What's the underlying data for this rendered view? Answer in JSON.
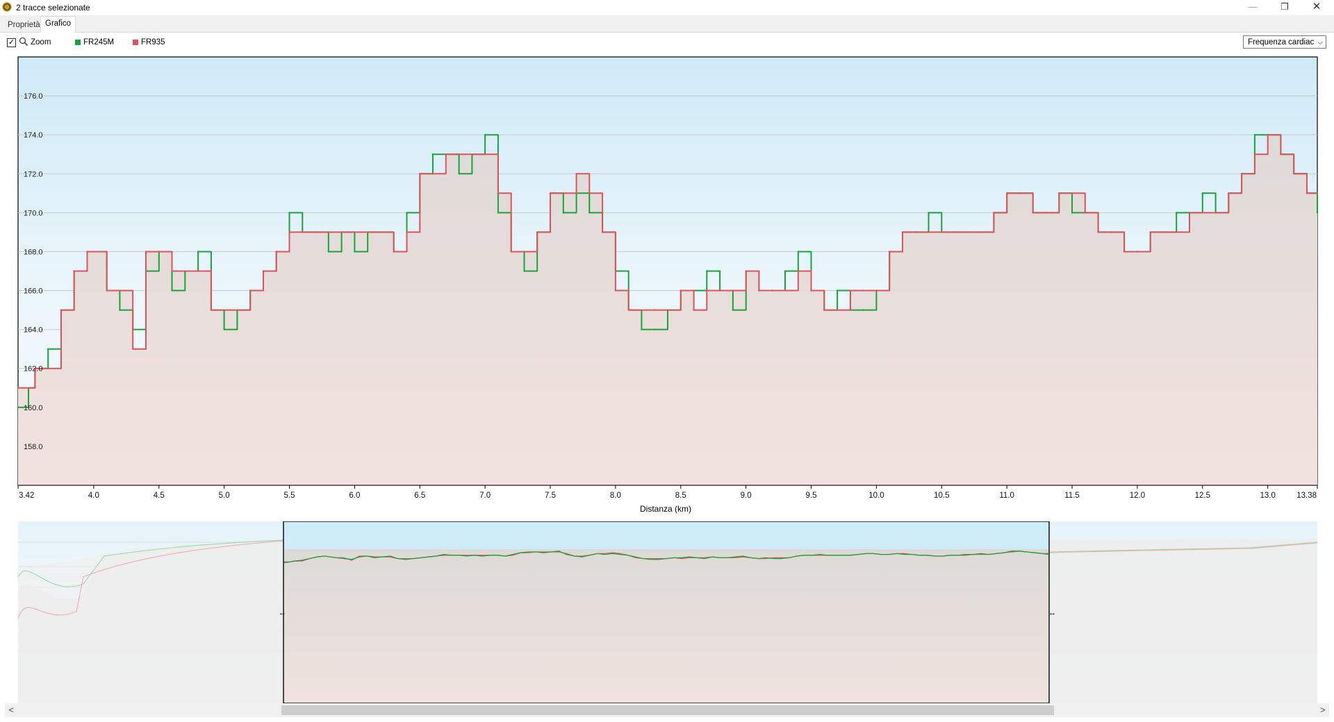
{
  "window": {
    "title": "2 tracce selezionate"
  },
  "window_buttons": {
    "minimize": "—",
    "restore": "❐",
    "close": "✕"
  },
  "tabs": [
    {
      "label": "Proprietà"
    },
    {
      "label": "Grafico"
    }
  ],
  "toolbar": {
    "zoom_checked": true,
    "zoom_label": "Zoom",
    "metric_select": "Frequenza cardiac"
  },
  "colors": {
    "FR245M": "#1aa33a",
    "FR935": "#e0525a"
  },
  "scrollbar": {
    "left_arrow": "<",
    "right_arrow": ">"
  },
  "chart_data": {
    "type": "line",
    "xlabel": "Distanza  (km)",
    "ylabel": "",
    "xlim": [
      3.42,
      13.38
    ],
    "ylim": [
      156.0,
      178.0
    ],
    "x_ticks": [
      "3.42",
      "4.0",
      "4.5",
      "5.0",
      "5.5",
      "6.0",
      "6.5",
      "7.0",
      "7.5",
      "8.0",
      "8.5",
      "9.0",
      "9.5",
      "10.0",
      "10.5",
      "11.0",
      "11.5",
      "12.0",
      "12.5",
      "13.0",
      "13.38"
    ],
    "y_ticks": [
      "158.0",
      "160.0",
      "162.0",
      "164.0",
      "166.0",
      "168.0",
      "170.0",
      "172.0",
      "174.0",
      "176.0"
    ],
    "grid": true,
    "legend": "top-left",
    "series": [
      {
        "name": "FR245M",
        "x": [
          3.42,
          3.5,
          3.55,
          3.65,
          3.75,
          3.85,
          3.95,
          4.1,
          4.2,
          4.3,
          4.4,
          4.5,
          4.6,
          4.7,
          4.8,
          4.9,
          5.0,
          5.1,
          5.2,
          5.3,
          5.4,
          5.5,
          5.6,
          5.7,
          5.8,
          5.9,
          6.0,
          6.1,
          6.2,
          6.3,
          6.4,
          6.5,
          6.6,
          6.7,
          6.8,
          6.9,
          7.0,
          7.1,
          7.2,
          7.3,
          7.4,
          7.5,
          7.6,
          7.7,
          7.8,
          7.9,
          8.0,
          8.1,
          8.2,
          8.3,
          8.4,
          8.5,
          8.6,
          8.7,
          8.8,
          8.9,
          9.0,
          9.1,
          9.2,
          9.3,
          9.4,
          9.5,
          9.6,
          9.7,
          9.8,
          9.9,
          10.0,
          10.1,
          10.2,
          10.3,
          10.4,
          10.5,
          10.6,
          10.7,
          10.8,
          10.9,
          11.0,
          11.1,
          11.2,
          11.3,
          11.4,
          11.5,
          11.6,
          11.7,
          11.8,
          11.9,
          12.0,
          12.1,
          12.2,
          12.3,
          12.4,
          12.5,
          12.6,
          12.7,
          12.8,
          12.9,
          13.0,
          13.1,
          13.2,
          13.3,
          13.38
        ],
        "values": [
          160,
          161,
          162,
          163,
          165,
          167,
          168,
          166,
          165,
          164,
          167,
          168,
          166,
          167,
          168,
          165,
          164,
          165,
          166,
          167,
          168,
          170,
          169,
          169,
          168,
          169,
          168,
          169,
          169,
          168,
          170,
          172,
          173,
          173,
          172,
          173,
          174,
          170,
          168,
          167,
          169,
          171,
          170,
          171,
          170,
          169,
          167,
          165,
          164,
          164,
          165,
          166,
          166,
          167,
          166,
          165,
          167,
          166,
          166,
          167,
          168,
          166,
          165,
          166,
          165,
          165,
          166,
          168,
          169,
          169,
          170,
          169,
          169,
          169,
          169,
          170,
          171,
          171,
          170,
          170,
          171,
          170,
          170,
          169,
          169,
          168,
          168,
          169,
          169,
          170,
          170,
          171,
          170,
          171,
          172,
          174,
          174,
          173,
          172,
          171,
          170
        ]
      },
      {
        "name": "FR935",
        "x": [
          3.42,
          3.5,
          3.55,
          3.65,
          3.75,
          3.85,
          3.95,
          4.1,
          4.2,
          4.3,
          4.4,
          4.5,
          4.6,
          4.7,
          4.8,
          4.9,
          5.0,
          5.1,
          5.2,
          5.3,
          5.4,
          5.5,
          5.6,
          5.7,
          5.8,
          5.9,
          6.0,
          6.1,
          6.2,
          6.3,
          6.4,
          6.5,
          6.6,
          6.7,
          6.8,
          6.9,
          7.0,
          7.1,
          7.2,
          7.3,
          7.4,
          7.5,
          7.6,
          7.7,
          7.8,
          7.9,
          8.0,
          8.1,
          8.2,
          8.3,
          8.4,
          8.5,
          8.6,
          8.7,
          8.8,
          8.9,
          9.0,
          9.1,
          9.2,
          9.3,
          9.4,
          9.5,
          9.6,
          9.7,
          9.8,
          9.9,
          10.0,
          10.1,
          10.2,
          10.3,
          10.4,
          10.5,
          10.6,
          10.7,
          10.8,
          10.9,
          11.0,
          11.1,
          11.2,
          11.3,
          11.4,
          11.5,
          11.6,
          11.7,
          11.8,
          11.9,
          12.0,
          12.1,
          12.2,
          12.3,
          12.4,
          12.5,
          12.6,
          12.7,
          12.8,
          12.9,
          13.0,
          13.1,
          13.2,
          13.3,
          13.38
        ],
        "values": [
          161,
          161,
          162,
          162,
          165,
          167,
          168,
          166,
          166,
          163,
          168,
          168,
          167,
          167,
          167,
          165,
          165,
          165,
          166,
          167,
          168,
          169,
          169,
          169,
          169,
          169,
          169,
          169,
          169,
          168,
          169,
          172,
          172,
          173,
          173,
          173,
          173,
          171,
          168,
          168,
          169,
          171,
          171,
          172,
          171,
          169,
          166,
          165,
          165,
          165,
          165,
          166,
          165,
          166,
          166,
          166,
          167,
          166,
          166,
          166,
          167,
          166,
          165,
          165,
          166,
          166,
          166,
          168,
          169,
          169,
          169,
          169,
          169,
          169,
          169,
          170,
          171,
          171,
          170,
          170,
          171,
          171,
          170,
          169,
          169,
          168,
          168,
          169,
          169,
          169,
          170,
          170,
          170,
          171,
          172,
          173,
          174,
          173,
          172,
          171,
          171
        ]
      }
    ]
  }
}
